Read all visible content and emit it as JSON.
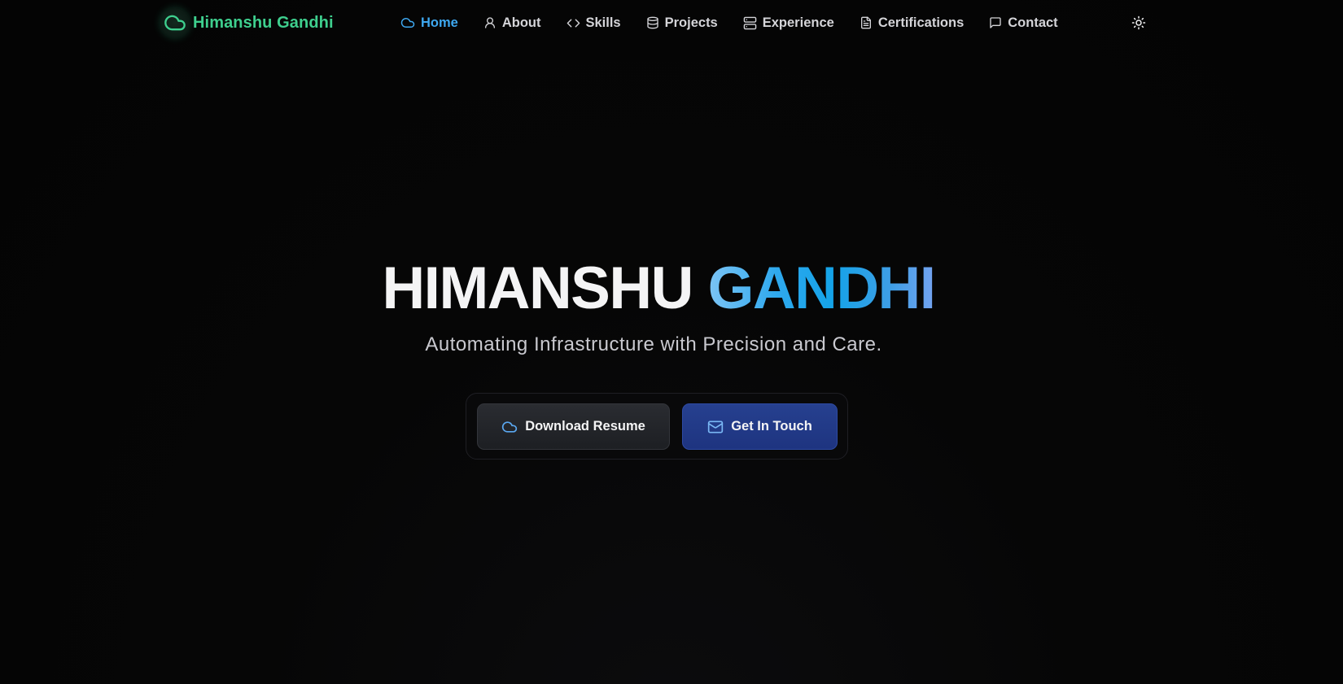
{
  "brand": {
    "name": "Himanshu Gandhi",
    "logo_icon": "cloud-icon",
    "color": "#3ecf8e"
  },
  "nav": {
    "items": [
      {
        "label": "Home",
        "icon": "cloud-icon",
        "active": true
      },
      {
        "label": "About",
        "icon": "user-icon",
        "active": false
      },
      {
        "label": "Skills",
        "icon": "code-icon",
        "active": false
      },
      {
        "label": "Projects",
        "icon": "database-icon",
        "active": false
      },
      {
        "label": "Experience",
        "icon": "server-icon",
        "active": false
      },
      {
        "label": "Certifications",
        "icon": "file-text-icon",
        "active": false
      },
      {
        "label": "Contact",
        "icon": "message-square-icon",
        "active": false
      }
    ],
    "active_color": "#3ea8f0",
    "theme_toggle_icon": "sun-icon"
  },
  "hero": {
    "first_name": "HIMANSHU",
    "last_name": "GANDHI",
    "tagline": "Automating Infrastructure with Precision and Care.",
    "buttons": {
      "resume": {
        "label": "Download Resume",
        "icon": "cloud-icon"
      },
      "contact": {
        "label": "Get In Touch",
        "icon": "mail-icon"
      }
    }
  }
}
